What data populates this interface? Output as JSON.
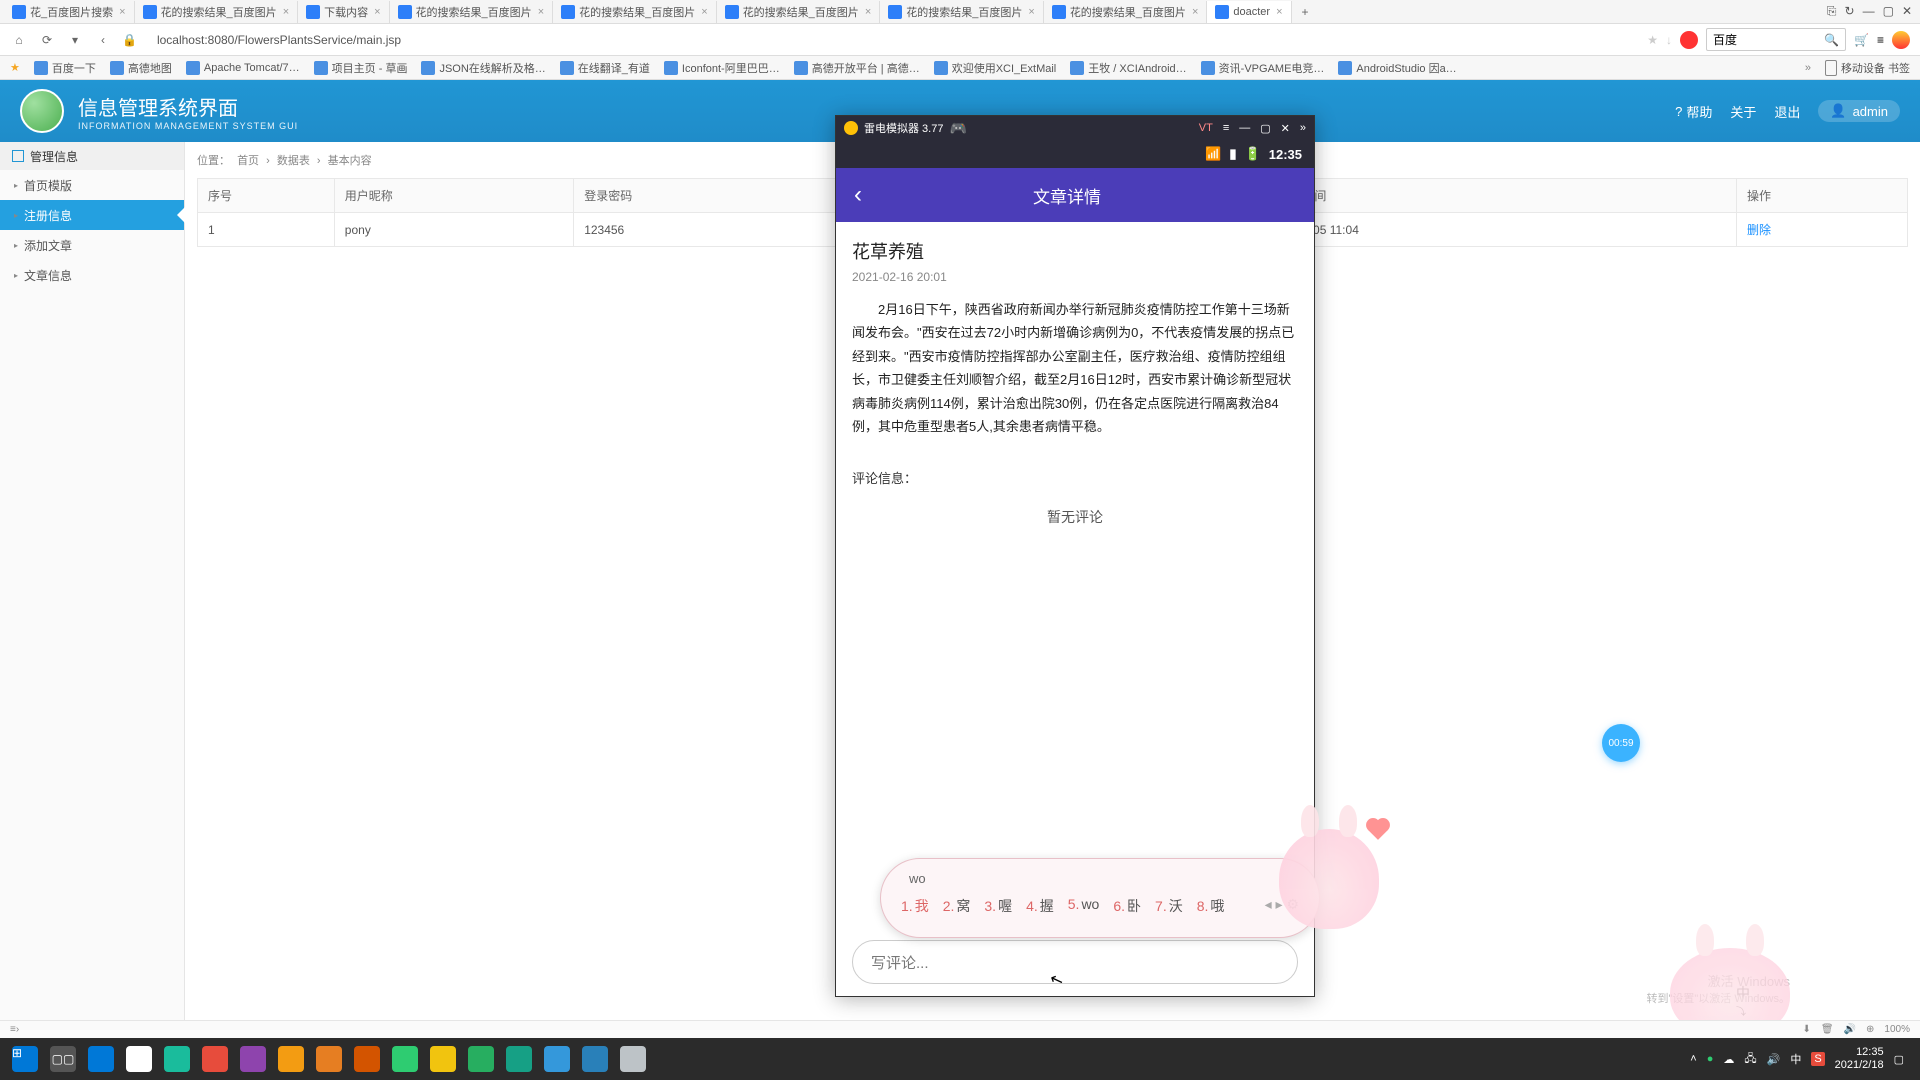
{
  "browser": {
    "tabs": [
      {
        "title": "花_百度图片搜索"
      },
      {
        "title": "花的搜索结果_百度图片"
      },
      {
        "title": "下载内容"
      },
      {
        "title": "花的搜索结果_百度图片"
      },
      {
        "title": "花的搜索结果_百度图片"
      },
      {
        "title": "花的搜索结果_百度图片"
      },
      {
        "title": "花的搜索结果_百度图片"
      },
      {
        "title": "花的搜索结果_百度图片"
      },
      {
        "title": "doacter",
        "active": true
      }
    ],
    "win_controls": [
      "⎘",
      "↻",
      "—",
      "▢",
      "✕"
    ],
    "nav": {
      "home": "⌂",
      "refresh": "⟳",
      "dropdown": "▾",
      "back": "‹"
    },
    "url": "localhost:8080/FlowersPlantsService/main.jsp",
    "search_engine": "百度",
    "bookmarks": [
      "百度一下",
      "高德地图",
      "Apache Tomcat/7…",
      "项目主页 - 草画",
      "JSON在线解析及格…",
      "在线翻译_有道",
      "Iconfont-阿里巴巴…",
      "高德开放平台 | 高德…",
      "欢迎使用XCI_ExtMail",
      "王牧 / XCIAndroid…",
      "资讯-VPGAME电竞…",
      "AndroidStudio 因a…"
    ],
    "bookmark_right": "移动设备 书签"
  },
  "app": {
    "title_cn": "信息管理系统界面",
    "title_en": "INFORMATION MANAGEMENT SYSTEM GUI",
    "header_links": {
      "help": "帮助",
      "about": "关于",
      "logout": "退出"
    },
    "user": "admin"
  },
  "sidebar": {
    "header": "管理信息",
    "items": [
      "首页模版",
      "注册信息",
      "添加文章",
      "文章信息"
    ],
    "active_index": 1
  },
  "breadcrumb": {
    "label": "位置：",
    "parts": [
      "首页",
      "数据表",
      "基本内容"
    ]
  },
  "table": {
    "headers": [
      "序号",
      "用户昵称",
      "登录密码",
      "…间",
      "操作"
    ],
    "rows": [
      {
        "seq": "1",
        "nick": "pony",
        "pwd": "123456",
        "time": "2-05 11:04",
        "op": "删除"
      }
    ]
  },
  "emulator": {
    "title": "雷电模拟器 3.77",
    "vt": "VT",
    "time": "12:35",
    "nav_title": "文章详情",
    "article_title": "花草养殖",
    "article_date": "2021-02-16 20:01",
    "article_text": "2月16日下午，陕西省政府新闻办举行新冠肺炎疫情防控工作第十三场新闻发布会。\"西安在过去72小时内新增确诊病例为0，不代表疫情发展的拐点已经到来。\"西安市疫情防控指挥部办公室副主任，医疗救治组、疫情防控组组长，市卫健委主任刘顺智介绍，截至2月16日12时，西安市累计确诊新型冠状病毒肺炎病例114例，累计治愈出院30例，仍在各定点医院进行隔离救治84例，其中危重型患者5人,其余患者病情平稳。",
    "comment_label": "评论信息：",
    "no_comment": "暂无评论",
    "comment_placeholder": "写评论..."
  },
  "ime": {
    "input": "wo",
    "candidates": [
      "1.我",
      "2.窝",
      "3.喔",
      "4.握",
      "5.wo",
      "6.卧",
      "7.沃",
      "8.哦"
    ]
  },
  "recorder": {
    "time": "00:59"
  },
  "watermark": {
    "line1": "激活 Windows",
    "line2": "转到\"设置\"以激活 Windows。"
  },
  "lang_indicator": "中",
  "status_bar": {
    "zoom": "100%"
  },
  "taskbar": {
    "icons_colors": [
      "#0078d7",
      "#fff",
      "#1abc9c",
      "#e74c3c",
      "#8e44ad",
      "#f39c12",
      "#e67e22",
      "#d35400",
      "#2ecc71",
      "#f1c40f",
      "#27ae60",
      "#16a085",
      "#3498db",
      "#2980b9",
      "#bdc3c7"
    ],
    "clock_time": "12:35",
    "clock_date": "2021/2/18"
  }
}
